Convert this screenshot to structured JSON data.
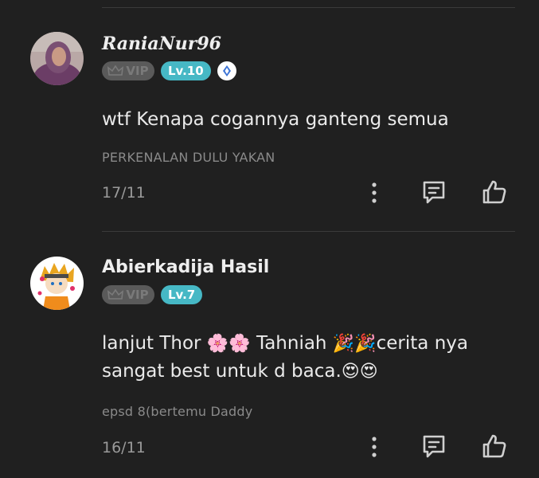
{
  "comments": [
    {
      "username": "RaniaNur96",
      "vip_label": "VIP",
      "level": "Lv.10",
      "text": "wtf Kenapa cogannya ganteng semua",
      "chapter": "PERKENALAN DULU YAKAN",
      "date": "17/11"
    },
    {
      "username": "Abierkadija Hasil",
      "vip_label": "VIP",
      "level": "Lv.7",
      "text_parts": {
        "p1": "lanjut Thor ",
        "blossom": "🌸",
        "p2": " Tahniah ",
        "party": "🎉",
        "p3": "cerita nya",
        "p4": "sangat best untuk d baca.",
        "heart_eyes": "😍"
      },
      "chapter": "epsd 8(bertemu Daddy",
      "date": "16/11"
    }
  ],
  "icons": {
    "more": "more-vertical-icon",
    "reply": "comment-bubble-icon",
    "like": "thumbs-up-icon",
    "crown": "crown-icon",
    "gem": "diamond-icon"
  },
  "colors": {
    "background": "#202020",
    "level_badge": "#46b8c5",
    "vip_badge": "#5a5a5a"
  }
}
